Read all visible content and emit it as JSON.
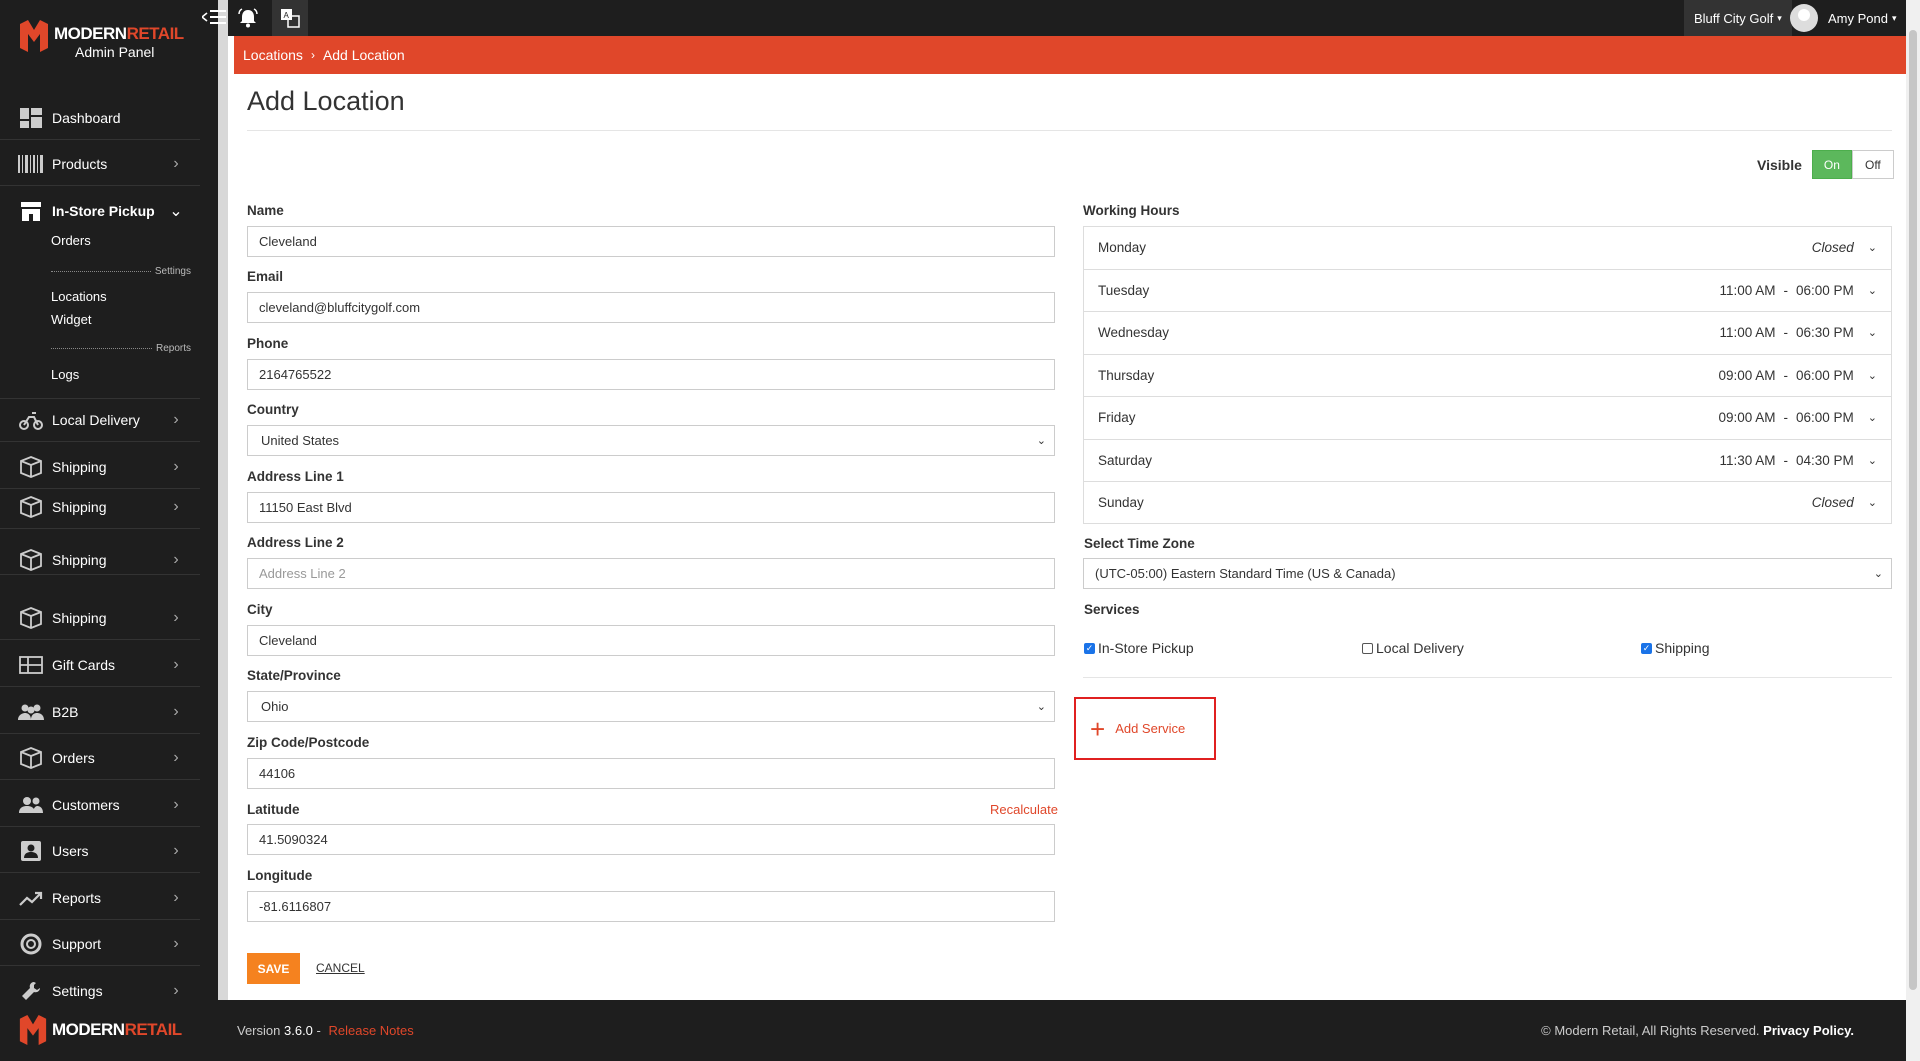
{
  "app": {
    "brand_left": "MODERN",
    "brand_right": "RETAIL",
    "subtitle": "Admin Panel"
  },
  "sidebar": {
    "items": [
      {
        "label": "Dashboard"
      },
      {
        "label": "Products"
      },
      {
        "label": "In-Store Pickup"
      },
      {
        "label": "Local Delivery"
      },
      {
        "label": "Shipping"
      },
      {
        "label": "Shipping"
      },
      {
        "label": "Shipping"
      },
      {
        "label": "Shipping"
      },
      {
        "label": "Gift Cards"
      },
      {
        "label": "B2B"
      },
      {
        "label": "Orders"
      },
      {
        "label": "Customers"
      },
      {
        "label": "Users"
      },
      {
        "label": "Reports"
      },
      {
        "label": "Support"
      },
      {
        "label": "Settings"
      }
    ],
    "sub": {
      "orders": "Orders",
      "settings_sep": "Settings",
      "locations": "Locations",
      "widget": "Widget",
      "reports_sep": "Reports",
      "logs": "Logs"
    }
  },
  "topbar": {
    "store": "Bluff City Golf",
    "user": "Amy Pond"
  },
  "breadcrumb": {
    "parent": "Locations",
    "current": "Add Location"
  },
  "page": {
    "title": "Add Location",
    "visible_label": "Visible",
    "on_label": "On",
    "off_label": "Off"
  },
  "form": {
    "name": {
      "label": "Name",
      "value": "Cleveland"
    },
    "email": {
      "label": "Email",
      "value": "cleveland@bluffcitygolf.com"
    },
    "phone": {
      "label": "Phone",
      "value": "2164765522"
    },
    "country": {
      "label": "Country",
      "value": "United States"
    },
    "address1": {
      "label": "Address Line 1",
      "value": "11150 East Blvd"
    },
    "address2": {
      "label": "Address Line 2",
      "placeholder": "Address Line 2"
    },
    "city": {
      "label": "City",
      "value": "Cleveland"
    },
    "state": {
      "label": "State/Province",
      "value": "Ohio"
    },
    "zip": {
      "label": "Zip Code/Postcode",
      "value": "44106"
    },
    "latitude": {
      "label": "Latitude",
      "value": "41.5090324"
    },
    "recalculate": "Recalculate",
    "longitude": {
      "label": "Longitude",
      "value": "-81.6116807"
    },
    "save": "SAVE",
    "cancel": "CANCEL"
  },
  "hours": {
    "label": "Working Hours",
    "days": [
      {
        "day": "Monday",
        "closed": "Closed"
      },
      {
        "day": "Tuesday",
        "open": "11:00 AM",
        "close": "06:00 PM"
      },
      {
        "day": "Wednesday",
        "open": "11:00 AM",
        "close": "06:30 PM"
      },
      {
        "day": "Thursday",
        "open": "09:00 AM",
        "close": "06:00 PM"
      },
      {
        "day": "Friday",
        "open": "09:00 AM",
        "close": "06:00 PM"
      },
      {
        "day": "Saturday",
        "open": "11:30 AM",
        "close": "04:30 PM"
      },
      {
        "day": "Sunday",
        "closed": "Closed"
      }
    ]
  },
  "timezone": {
    "label": "Select Time Zone",
    "value": "(UTC-05:00) Eastern Standard Time (US & Canada)"
  },
  "services": {
    "label": "Services",
    "items": [
      {
        "label": "In-Store Pickup",
        "checked": true
      },
      {
        "label": "Local Delivery",
        "checked": false
      },
      {
        "label": "Shipping",
        "checked": true
      }
    ],
    "add": "Add Service"
  },
  "footer": {
    "version_prefix": "Version",
    "version": "3.6.0",
    "dash": " - ",
    "release_notes": "Release Notes",
    "copyright": "© Modern Retail, All Rights Reserved.",
    "privacy": "Privacy Policy."
  },
  "colors": {
    "accent": "#e0472a",
    "save": "#f5821f",
    "on": "#5cb85c",
    "sidebar": "#1e1e1e"
  }
}
